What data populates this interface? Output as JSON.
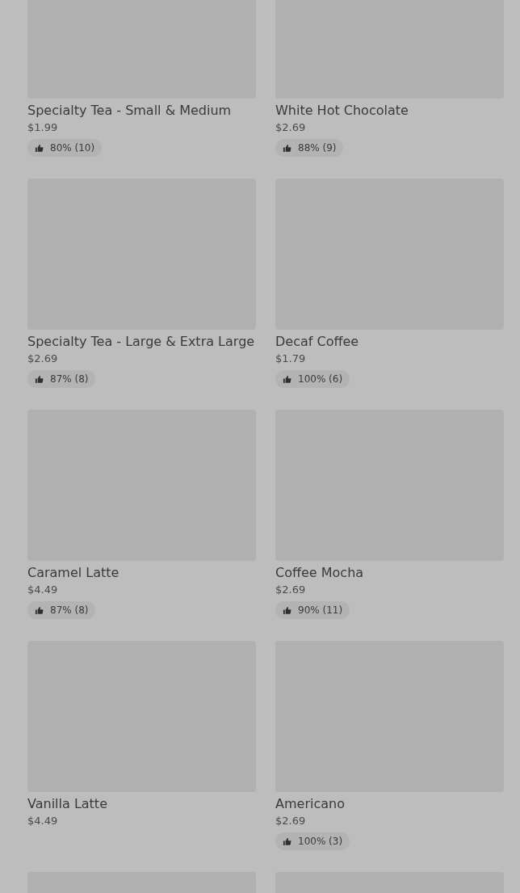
{
  "menu_items": [
    {
      "kind": "item",
      "name": "Specialty Tea - Small & Medium",
      "price": "$1.99",
      "rating": "80% (10)"
    },
    {
      "kind": "item",
      "name": "White Hot Chocolate",
      "price": "$2.69",
      "rating": "88% (9)"
    },
    {
      "kind": "item",
      "name": "Specialty Tea - Large & Extra Large",
      "price": "$2.69",
      "rating": "87% (8)"
    },
    {
      "kind": "item",
      "name": "Decaf Coffee",
      "price": "$1.79",
      "rating": "100% (6)"
    },
    {
      "kind": "item",
      "name": "Caramel Latte",
      "price": "$4.49",
      "rating": "87% (8)"
    },
    {
      "kind": "item",
      "name": "Coffee Mocha",
      "price": "$2.69",
      "rating": "90% (11)"
    },
    {
      "kind": "item",
      "name": "Vanilla Latte",
      "price": "$4.49"
    },
    {
      "kind": "item",
      "name": "Americano",
      "price": "$2.69",
      "rating": "100% (3)"
    },
    {
      "kind": "image_only"
    },
    {
      "kind": "image_only"
    }
  ]
}
